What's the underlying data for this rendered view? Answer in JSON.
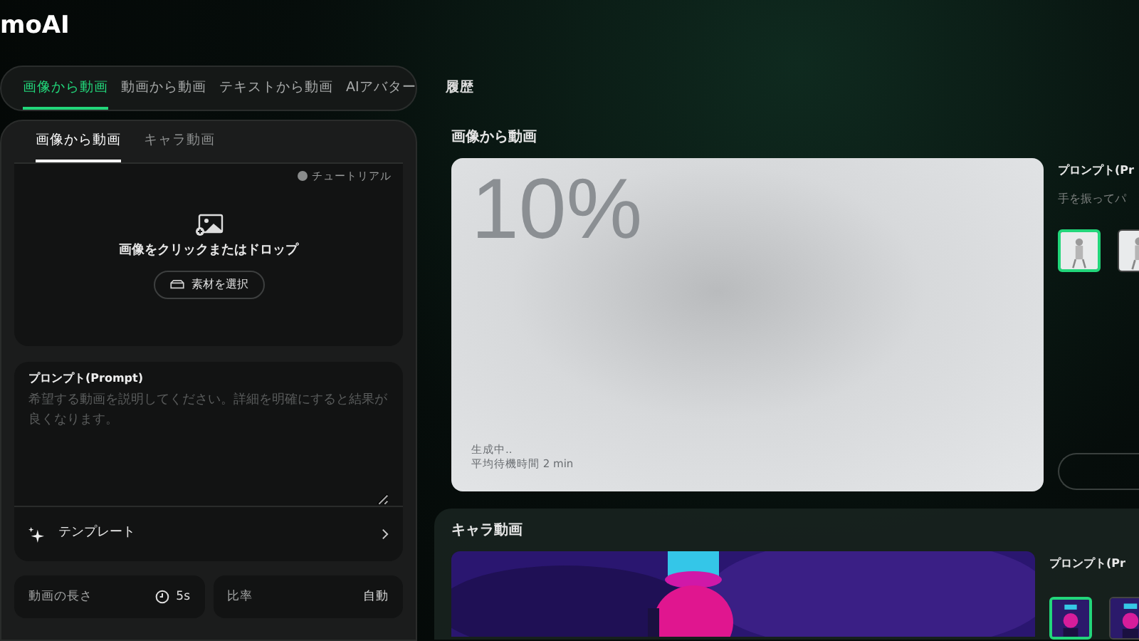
{
  "app": {
    "logo": "moAI"
  },
  "mode_tabs": [
    {
      "label": "画像から動画",
      "selected": true
    },
    {
      "label": "動画から動画",
      "selected": false
    },
    {
      "label": "テキストから動画",
      "selected": false
    },
    {
      "label": "AIアバター",
      "selected": false
    }
  ],
  "sub_tabs": [
    {
      "label": "画像から動画",
      "selected": true
    },
    {
      "label": "キャラ動画",
      "selected": false
    }
  ],
  "upload": {
    "tutorial": "チュートリアル",
    "hint": "画像をクリックまたはドロップ",
    "button": "素材を選択"
  },
  "prompt": {
    "label": "プロンプト(Prompt)",
    "placeholder": "希望する動画を説明してください。詳細を明確にすると結果が良くなります。"
  },
  "template": {
    "label": "テンプレート"
  },
  "settings": [
    {
      "label": "動画の長さ",
      "value": "5s",
      "kind": "duration"
    },
    {
      "label": "比率",
      "value": "自動",
      "kind": "plain"
    }
  ],
  "history": {
    "title": "履歴",
    "cards": [
      {
        "title": "画像から動画",
        "kind": "generating",
        "progress": "10%",
        "status": "生成中..",
        "wait": "平均待機時間 2 min",
        "prompt_label": "プロンプト(Pr",
        "prompt_text": "手を振ってパ",
        "thumbnails": [
          {
            "selected": true
          },
          {
            "selected": false
          }
        ]
      },
      {
        "title": "キャラ動画",
        "kind": "done",
        "prompt_label": "プロンプト(Pr",
        "thumbnails": [
          {
            "selected": true
          },
          {
            "selected": false
          }
        ]
      }
    ]
  }
}
